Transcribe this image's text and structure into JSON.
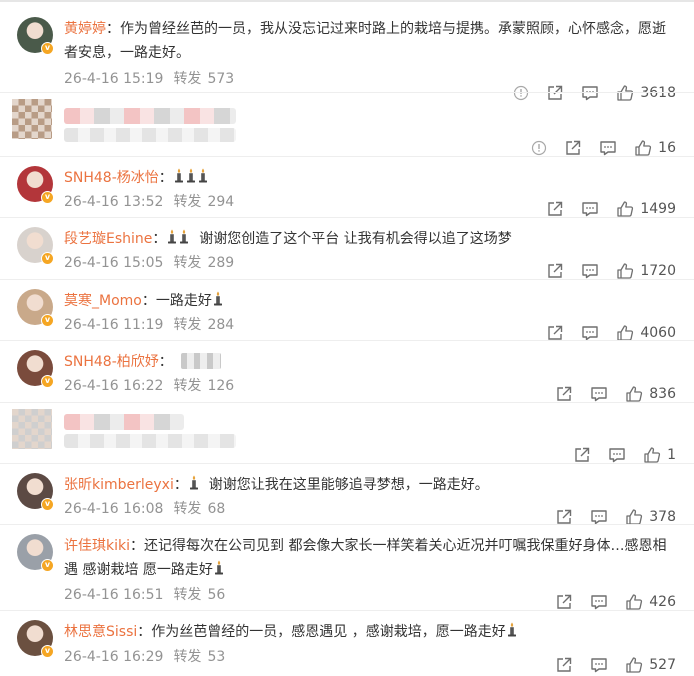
{
  "comments": [
    {
      "user": "黄婷婷",
      "text": "作为曾经丝芭的一员，我从没忘记过来时路上的栽培与提携。承蒙照顾，心怀感念，愿逝者安息，一路走好。",
      "date": "26-4-16 15:19",
      "repost_label": "转发",
      "reposts": "573",
      "likes": "3618",
      "avatar_color": "#4a5a4a",
      "has_report": true
    },
    {
      "user": "",
      "text": "",
      "date": "",
      "repost_label": "",
      "reposts": "",
      "likes": "16",
      "avatar_color": "#b89c86",
      "has_report": true,
      "blurred": true
    },
    {
      "user": "SNH48-杨冰怡",
      "text": "",
      "date": "26-4-16 13:52",
      "repost_label": "转发",
      "reposts": "294",
      "likes": "1499",
      "avatar_color": "#b3363a",
      "candles_before": 3
    },
    {
      "user": "段艺璇Eshine",
      "text": "谢谢您创造了这个平台 让我有机会得以追了这场梦",
      "date": "26-4-16 15:05",
      "repost_label": "转发",
      "reposts": "289",
      "likes": "1720",
      "avatar_color": "#d8d2cd",
      "candles_before": 2
    },
    {
      "user": "莫寒_Momo",
      "text": "一路走好",
      "date": "26-4-16 11:19",
      "repost_label": "转发",
      "reposts": "284",
      "likes": "4060",
      "avatar_color": "#c9a98a",
      "candles_after": 1
    },
    {
      "user": "SNH48-柏欣妤",
      "text": "",
      "date": "26-4-16 16:22",
      "repost_label": "转发",
      "reposts": "126",
      "likes": "836",
      "avatar_color": "#7a4b3c"
    },
    {
      "user": "",
      "text": "",
      "date": "",
      "repost_label": "",
      "reposts": "",
      "likes": "1",
      "avatar_color": "#cfcfcf",
      "blurred": true
    },
    {
      "user": "张昕kimberleyxi",
      "text": "谢谢您让我在这里能够追寻梦想，一路走好。",
      "date": "26-4-16 16:08",
      "repost_label": "转发",
      "reposts": "68",
      "likes": "378",
      "avatar_color": "#5c4a44",
      "candles_before": 1
    },
    {
      "user": "许佳琪kiki",
      "text": "还记得每次在公司见到 都会像大家长一样笑着关心近况并叮嘱我保重好身体…感恩相遇 感谢栽培 愿一路走好",
      "date": "26-4-16 16:51",
      "repost_label": "转发",
      "reposts": "56",
      "likes": "426",
      "avatar_color": "#9aa0a8",
      "candles_after": 1
    },
    {
      "user": "林思意Sissi",
      "text": "作为丝芭曾经的一员，感恩遇见 ，感谢栽培，愿一路走好",
      "date": "26-4-16 16:29",
      "repost_label": "转发",
      "reposts": "53",
      "likes": "527",
      "avatar_color": "#6b5040",
      "candles_after": 1
    }
  ],
  "colon": "：",
  "colors": {
    "username": "#eb7340",
    "meta": "#939393",
    "badge": "#f5a623"
  }
}
